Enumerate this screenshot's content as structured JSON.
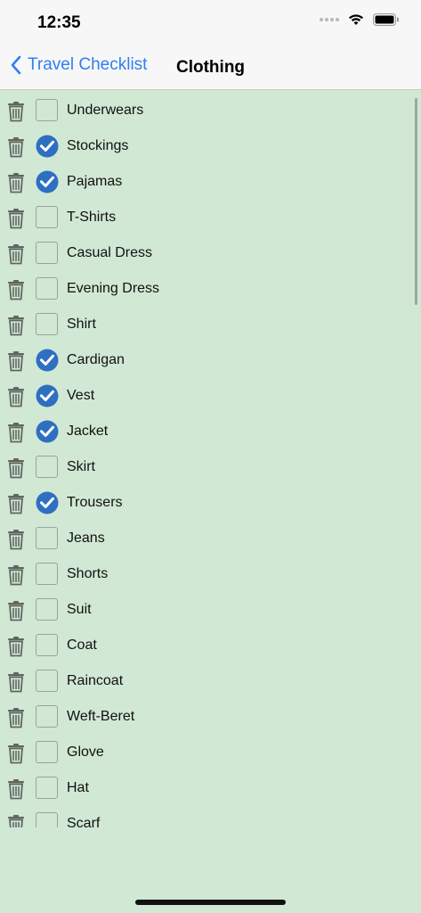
{
  "status": {
    "time": "12:35"
  },
  "nav": {
    "back_label": "Travel Checklist",
    "title": "Clothing"
  },
  "items": [
    {
      "label": "Underwears",
      "checked": false
    },
    {
      "label": "Stockings",
      "checked": true
    },
    {
      "label": "Pajamas",
      "checked": true
    },
    {
      "label": "T-Shirts",
      "checked": false
    },
    {
      "label": "Casual Dress",
      "checked": false
    },
    {
      "label": "Evening Dress",
      "checked": false
    },
    {
      "label": "Shirt",
      "checked": false
    },
    {
      "label": "Cardigan",
      "checked": true
    },
    {
      "label": "Vest",
      "checked": true
    },
    {
      "label": "Jacket",
      "checked": true
    },
    {
      "label": "Skirt",
      "checked": false
    },
    {
      "label": "Trousers",
      "checked": true
    },
    {
      "label": "Jeans",
      "checked": false
    },
    {
      "label": "Shorts",
      "checked": false
    },
    {
      "label": "Suit",
      "checked": false
    },
    {
      "label": "Coat",
      "checked": false
    },
    {
      "label": "Raincoat",
      "checked": false
    },
    {
      "label": "Weft-Beret",
      "checked": false
    },
    {
      "label": "Glove",
      "checked": false
    },
    {
      "label": "Hat",
      "checked": false
    },
    {
      "label": "Scarf",
      "checked": false
    }
  ],
  "colors": {
    "accent": "#2f7ef3",
    "check_fill": "#2f6fc2",
    "background": "#d1e8d4"
  },
  "icons": {
    "trash": "trash-icon",
    "check": "checkmark-circle-icon",
    "back": "chevron-left-icon"
  }
}
